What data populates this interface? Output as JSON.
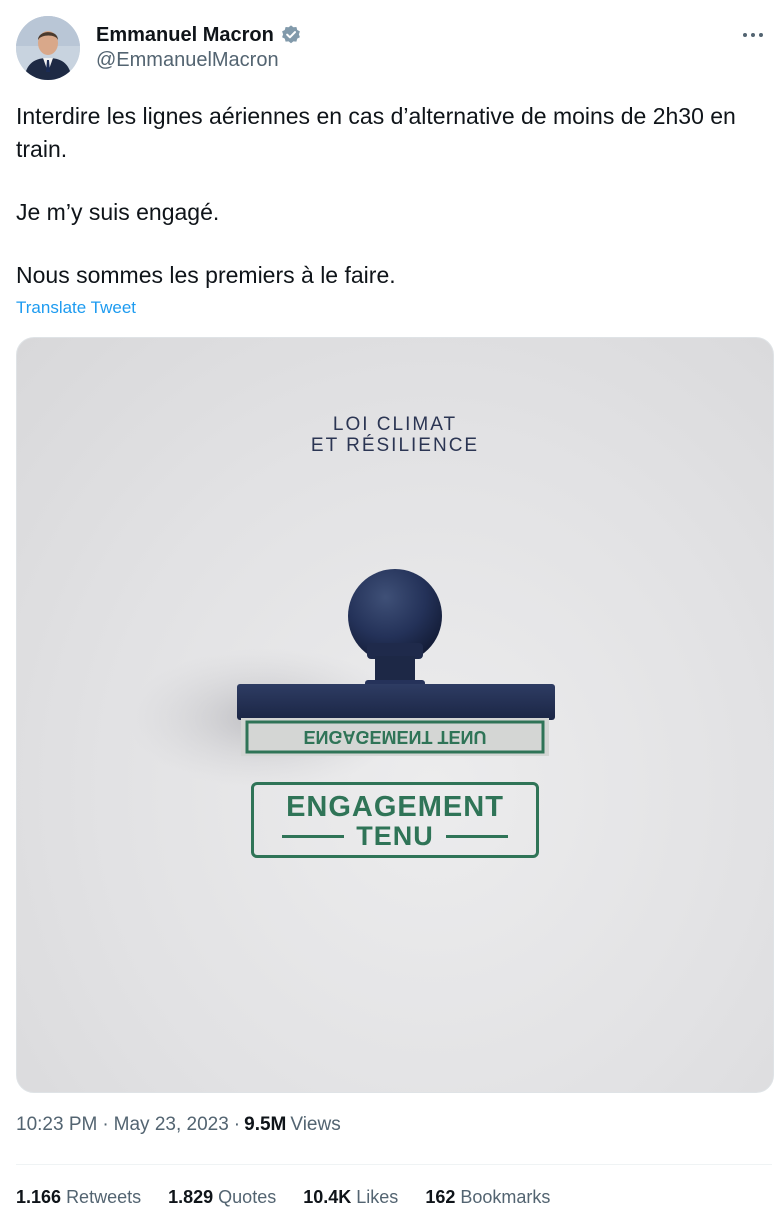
{
  "author": {
    "display_name": "Emmanuel Macron",
    "handle": "@EmmanuelMacron",
    "verified": true
  },
  "icons": {
    "verified": "verified-badge-icon",
    "more": "more-horizontal-icon"
  },
  "tweet": {
    "paragraphs": [
      "Interdire les lignes aériennes en cas d’alternative de moins de 2h30 en train.",
      "Je m’y suis engagé.",
      "Nous sommes les premiers à le faire."
    ],
    "translate_label": "Translate Tweet"
  },
  "media": {
    "title_line1": "LOI CLIMAT",
    "title_line2": "ET RÉSILIENCE",
    "stamp_line1": "ENGAGEMENT",
    "stamp_line2": "TENU",
    "stamp_reflection": "ENGAGEMENT TENU"
  },
  "meta": {
    "time": "10:23 PM",
    "separator": "·",
    "date": "May 23, 2023",
    "views_count": "9.5M",
    "views_label": "Views"
  },
  "stats": [
    {
      "count": "1.166",
      "label": "Retweets"
    },
    {
      "count": "1.829",
      "label": "Quotes"
    },
    {
      "count": "10.4K",
      "label": "Likes"
    },
    {
      "count": "162",
      "label": "Bookmarks"
    }
  ],
  "colors": {
    "text_primary": "#0f1419",
    "text_secondary": "#536471",
    "link": "#1d9bf0",
    "verified": "#829aab",
    "stamp_ink": "#2f7457",
    "stamp_handle": "#2a3656"
  }
}
